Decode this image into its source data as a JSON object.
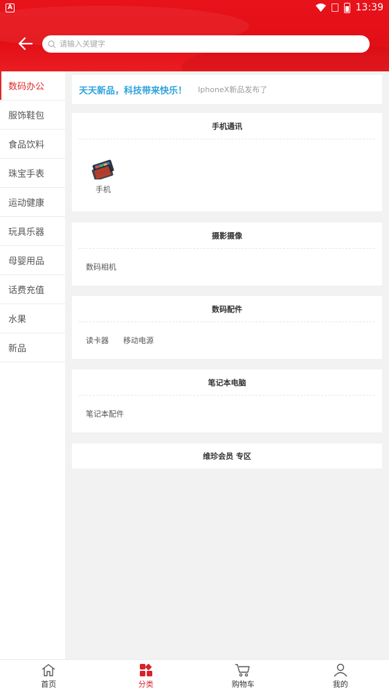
{
  "statusbar": {
    "time": "13:39",
    "left_badge": "A"
  },
  "search": {
    "placeholder": "请输入关键字"
  },
  "sidebar": {
    "items": [
      {
        "label": "数码办公",
        "active": true
      },
      {
        "label": "服饰鞋包"
      },
      {
        "label": "食品饮料"
      },
      {
        "label": "珠宝手表"
      },
      {
        "label": "运动健康"
      },
      {
        "label": "玩具乐器"
      },
      {
        "label": "母婴用品"
      },
      {
        "label": "话费充值"
      },
      {
        "label": "水果"
      },
      {
        "label": "新品"
      }
    ]
  },
  "news": {
    "title": "天天新品，科技带来快乐！",
    "text": "IphoneX新品发布了"
  },
  "sections": [
    {
      "title": "手机通讯",
      "items": [
        "手机"
      ]
    },
    {
      "title": "摄影摄像",
      "items": [
        "数码相机"
      ]
    },
    {
      "title": "数码配件",
      "items": [
        "读卡器",
        "移动电源"
      ]
    },
    {
      "title": "笔记本电脑",
      "items": [
        "笔记本配件"
      ]
    },
    {
      "title": "维珍会员 专区",
      "items": []
    }
  ],
  "tabbar": {
    "tabs": [
      {
        "label": "首页",
        "icon": "home-icon"
      },
      {
        "label": "分类",
        "icon": "category-icon",
        "active": true
      },
      {
        "label": "购物车",
        "icon": "cart-icon"
      },
      {
        "label": "我的",
        "icon": "user-icon"
      }
    ]
  },
  "colors": {
    "brand_red": "#e30f16",
    "active_red": "#e02a2a",
    "news_blue": "#2ea3dc"
  }
}
